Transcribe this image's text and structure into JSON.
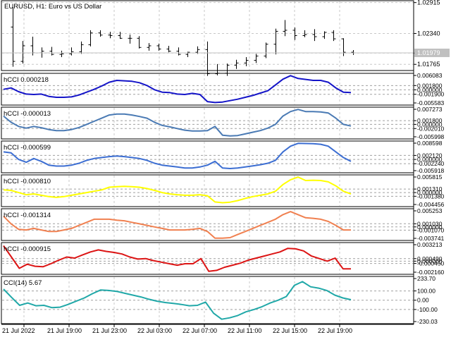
{
  "window": {
    "symbol_title": "EURUSD, H1:  Euro vs US Dollar"
  },
  "main_chart": {
    "y_axis_labels": [
      "1.02915",
      "1.02340",
      "1.01975",
      "1.01765"
    ],
    "current_price": "1.01979"
  },
  "panes": [
    {
      "title": "hCCI 0.000218",
      "axis_labels": [
        "0.006083",
        "0.001800",
        "0.000000",
        "-0.001900",
        "-0.005583"
      ],
      "line_color": "#1414c8"
    },
    {
      "title": "hCCI -0.000013",
      "axis_labels": [
        "0.007273",
        "0.001800",
        "0.000000",
        "-0.002010",
        "-0.005998"
      ],
      "line_color": "#4a7ab4"
    },
    {
      "title": "hCCI -0.000599",
      "axis_labels": [
        "0.008598",
        "0.002120",
        "0.000000",
        "-0.002240",
        "-0.005918"
      ],
      "line_color": "#3c6ed2"
    },
    {
      "title": "hCCI -0.000810",
      "axis_labels": [
        "0.005815",
        "0.001310",
        "0.000000",
        "-0.001380",
        "-0.004456"
      ],
      "line_color": "#ffff00"
    },
    {
      "title": "hCCI -0.001314",
      "axis_labels": [
        "0.005253",
        "0.001030",
        "0.000000",
        "-0.001070",
        "-0.003741"
      ],
      "line_color": "#f08050"
    },
    {
      "title": "hCCI -0.000915",
      "axis_labels": [
        "0.003213",
        "0.000490",
        "0.000000",
        "-0.000450",
        "-0.002160"
      ],
      "line_color": "#dc1414"
    },
    {
      "title": "CCI(14) 5.67",
      "axis_labels": [
        "233.70",
        "100.00",
        "0.00",
        "-100.00",
        "-230.03"
      ],
      "line_color": "#20a8a8"
    }
  ],
  "time_axis": [
    "21 Jul 2022",
    "21 Jul 19:00",
    "21 Jul 23:00",
    "22 Jul 03:00",
    "22 Jul 07:00",
    "22 Jul 11:00",
    "22 Jul 15:00",
    "22 Jul 19:00"
  ],
  "colors": {
    "background": "#ffffff",
    "grid": "#c8c8c8",
    "candle": "#000000",
    "bid_line": "#c0c0c0"
  },
  "chart_data": [
    {
      "type": "candlestick",
      "series": [
        {
          "ohlc": [
            [
              1.0246,
              1.0283,
              1.0172,
              1.0182
            ],
            [
              1.0182,
              1.022,
              1.0178,
              1.0211
            ],
            [
              1.0211,
              1.0228,
              1.0193,
              1.0198
            ],
            [
              1.0198,
              1.0208,
              1.0189,
              1.0201
            ],
            [
              1.0201,
              1.0209,
              1.0193,
              1.0195
            ],
            [
              1.0195,
              1.0202,
              1.019,
              1.0196
            ],
            [
              1.0196,
              1.0208,
              1.0193,
              1.02
            ],
            [
              1.02,
              1.0219,
              1.0196,
              1.0213
            ],
            [
              1.0213,
              1.024,
              1.021,
              1.0235
            ],
            [
              1.0235,
              1.024,
              1.0228,
              1.0231
            ],
            [
              1.0231,
              1.0237,
              1.0225,
              1.023
            ],
            [
              1.023,
              1.0237,
              1.0224,
              1.0225
            ],
            [
              1.0225,
              1.0232,
              1.0215,
              1.0225
            ],
            [
              1.0225,
              1.0229,
              1.0206,
              1.0208
            ],
            [
              1.0208,
              1.0216,
              1.0202,
              1.0211
            ],
            [
              1.0211,
              1.0215,
              1.0202,
              1.0205
            ],
            [
              1.0205,
              1.0211,
              1.0199,
              1.0201
            ],
            [
              1.0201,
              1.0208,
              1.0193,
              1.0195
            ],
            [
              1.0195,
              1.02,
              1.019,
              1.0199
            ],
            [
              1.0199,
              1.021,
              1.0196,
              1.0204
            ],
            [
              1.0204,
              1.0219,
              1.0155,
              1.0159
            ],
            [
              1.0159,
              1.0177,
              1.0156,
              1.016
            ],
            [
              1.016,
              1.0178,
              1.0155,
              1.0175
            ],
            [
              1.0175,
              1.0185,
              1.0168,
              1.0179
            ],
            [
              1.0179,
              1.019,
              1.0173,
              1.0184
            ],
            [
              1.0184,
              1.0196,
              1.0179,
              1.0192
            ],
            [
              1.0192,
              1.0217,
              1.0188,
              1.0214
            ],
            [
              1.0214,
              1.0243,
              1.0195,
              1.0238
            ],
            [
              1.0238,
              1.0259,
              1.0229,
              1.024
            ],
            [
              1.024,
              1.0245,
              1.0222,
              1.023
            ],
            [
              1.023,
              1.024,
              1.0227,
              1.0232
            ],
            [
              1.0232,
              1.0242,
              1.022,
              1.0228
            ],
            [
              1.0228,
              1.0238,
              1.0224,
              1.0236
            ],
            [
              1.0236,
              1.024,
              1.022,
              1.0224
            ],
            [
              1.0224,
              1.0225,
              1.0192,
              1.0199
            ],
            [
              1.0199,
              1.0203,
              1.0194,
              1.01979
            ]
          ]
        }
      ],
      "ylim": [
        1.0165,
        1.0295
      ]
    },
    {
      "type": "line",
      "series": [
        {
          "values": [
            0.0002,
            0.0008,
            -0.0008,
            -0.0018,
            -0.002,
            -0.0018,
            -0.0028,
            -0.0032,
            -0.0032,
            -0.003,
            -0.0022,
            -0.001,
            0.0002,
            0.0016,
            0.0032,
            0.004,
            0.0038,
            0.0036,
            0.003,
            0.0018,
            0.0,
            -0.001,
            -0.0012,
            -0.0018,
            -0.002,
            -0.0015,
            -0.002,
            -0.005,
            -0.0054,
            -0.0052,
            -0.0046,
            -0.004,
            -0.0032,
            -0.0024,
            -0.0014,
            -0.0004,
            0.002,
            0.0045,
            0.006,
            0.0048,
            0.0044,
            0.004,
            0.004,
            0.0032,
            0.0008,
            -0.001,
            -0.0012
          ]
        }
      ],
      "ylim": [
        -0.005583,
        0.006083
      ]
    },
    {
      "type": "line",
      "series": [
        {
          "values": [
            0.004,
            0.001,
            -0.001,
            -0.0018,
            -0.001,
            -0.0016,
            -0.0025,
            -0.003,
            -0.003,
            -0.0025,
            -0.0015,
            0.0,
            0.0015,
            0.003,
            0.0045,
            0.005,
            0.005,
            0.0045,
            0.0038,
            0.003,
            0.001,
            -0.0005,
            -0.0012,
            -0.002,
            -0.0028,
            -0.0032,
            -0.0032,
            -0.003,
            -0.001,
            -0.0052,
            -0.0056,
            -0.0054,
            -0.0046,
            -0.0038,
            -0.003,
            -0.0018,
            0.0,
            0.004,
            0.0062,
            0.0072,
            0.0062,
            0.0062,
            0.006,
            0.0055,
            0.003,
            0.0,
            -0.0008
          ]
        }
      ],
      "ylim": [
        -0.005998,
        0.007273
      ]
    },
    {
      "type": "line",
      "series": [
        {
          "values": [
            0.004,
            0.0035,
            0.0,
            -0.0015,
            0.0005,
            -0.001,
            -0.003,
            -0.0035,
            -0.0035,
            -0.003,
            -0.002,
            -0.0005,
            0.0005,
            0.001,
            0.0015,
            0.0018,
            0.0015,
            0.001,
            0.0005,
            -0.0005,
            -0.002,
            -0.003,
            -0.0035,
            -0.004,
            -0.0045,
            -0.0045,
            -0.004,
            -0.003,
            -0.001,
            -0.0045,
            -0.0048,
            -0.0045,
            -0.004,
            -0.0034,
            -0.0028,
            -0.002,
            -0.0005,
            0.004,
            0.007,
            0.0085,
            0.0084,
            0.0083,
            0.008,
            0.007,
            0.004,
            0.001,
            -0.001
          ]
        }
      ],
      "ylim": [
        -0.005918,
        0.008598
      ]
    },
    {
      "type": "line",
      "series": [
        {
          "values": [
            0.001,
            0.0008,
            0.0,
            -0.0008,
            -0.0005,
            -0.001,
            -0.0015,
            -0.0018,
            -0.0015,
            -0.001,
            -0.0005,
            0.0,
            0.0005,
            0.001,
            0.002,
            0.0022,
            0.0023,
            0.0022,
            0.002,
            0.0015,
            0.0008,
            0.0,
            -0.0005,
            -0.0008,
            -0.001,
            -0.001,
            -0.0008,
            -0.0012,
            -0.0035,
            -0.0038,
            -0.0036,
            -0.003,
            -0.0022,
            -0.0015,
            -0.001,
            -0.0005,
            0.0005,
            0.003,
            0.0048,
            0.0058,
            0.0045,
            0.0046,
            0.0045,
            0.004,
            0.0025,
            0.0005,
            -0.0005
          ]
        }
      ],
      "ylim": [
        -0.004456,
        0.005815
      ]
    },
    {
      "type": "line",
      "series": [
        {
          "values": [
            0.0035,
            0.001,
            -0.0008,
            -0.001,
            -0.0005,
            -0.001,
            -0.0015,
            -0.0015,
            -0.001,
            -0.0005,
            0.0005,
            0.0015,
            0.0025,
            0.0025,
            0.0025,
            0.0022,
            0.002,
            0.0015,
            0.001,
            0.0005,
            0.0,
            -0.0005,
            -0.001,
            -0.001,
            -0.001,
            -0.0008,
            -0.0005,
            -0.0015,
            -0.0037,
            -0.0037,
            -0.0035,
            -0.0025,
            -0.0015,
            -0.0005,
            0.0005,
            0.0015,
            0.0025,
            0.004,
            0.005,
            0.004,
            0.003,
            0.0028,
            0.0025,
            0.0018,
            0.0005,
            -0.001,
            -0.001
          ]
        }
      ],
      "ylim": [
        -0.003741,
        0.005253
      ]
    },
    {
      "type": "line",
      "series": [
        {
          "values": [
            0.003,
            0.0008,
            -0.0014,
            -0.0006,
            -0.001,
            -0.0011,
            -0.0005,
            0.0002,
            0.0008,
            0.0006,
            0.0012,
            0.0018,
            0.0022,
            0.0019,
            0.0017,
            0.0014,
            0.0008,
            0.0004,
            0.0005,
            0.0001,
            -0.0002,
            -0.0005,
            -0.0008,
            -0.0005,
            -0.0005,
            0.0005,
            -0.002,
            -0.0018,
            -0.0012,
            -0.0008,
            -0.0004,
            0.0002,
            0.0006,
            0.001,
            0.0014,
            0.0018,
            0.0025,
            0.0024,
            0.002,
            0.001,
            0.0005,
            0.0,
            0.0006,
            -0.0015,
            -0.0015
          ]
        }
      ],
      "ylim": [
        -0.00216,
        0.003213
      ]
    },
    {
      "type": "line",
      "series": [
        {
          "values": [
            120,
            30,
            -55,
            -30,
            -60,
            -55,
            -80,
            -75,
            -45,
            -10,
            25,
            70,
            110,
            105,
            95,
            75,
            55,
            35,
            10,
            -10,
            -25,
            -35,
            -45,
            -60,
            -55,
            -20,
            -140,
            -205,
            -190,
            -165,
            -125,
            -100,
            -70,
            -30,
            0,
            40,
            160,
            200,
            145,
            130,
            105,
            55,
            25,
            6
          ]
        }
      ],
      "ylim": [
        -230.03,
        233.7
      ]
    }
  ]
}
